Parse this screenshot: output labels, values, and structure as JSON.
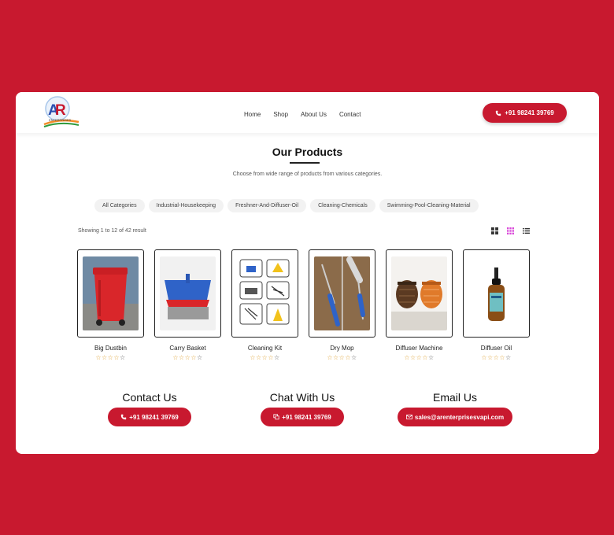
{
  "brand": {
    "logo_text": "ENTERPRISES",
    "logo_letters": "AR"
  },
  "nav": [
    "Home",
    "Shop",
    "About Us",
    "Contact"
  ],
  "header_phone": "+91 98241 39769",
  "section": {
    "title": "Our Products",
    "subtitle": "Choose from wide range of products from various categories."
  },
  "filters": [
    "All Categories",
    "Industrial-Housekeeping",
    "Freshner-And-Diffuser-Oil",
    "Cleaning-Chemicals",
    "Swimming-Pool-Cleaning-Material"
  ],
  "showing": "Showing 1 to 12 of 42 result",
  "view_icons": [
    "grid-large-icon",
    "grid-small-icon",
    "list-icon"
  ],
  "products": [
    {
      "name": "Big Dustbin",
      "rating": 0
    },
    {
      "name": "Carry Basket",
      "rating": 0
    },
    {
      "name": "Cleaning Kit",
      "rating": 0
    },
    {
      "name": "Dry Mop",
      "rating": 0
    },
    {
      "name": "Diffuser Machine",
      "rating": 0
    },
    {
      "name": "Diffuser Oil",
      "rating": 0
    }
  ],
  "contact": {
    "call": {
      "heading": "Contact Us",
      "label": "+91 98241 39769"
    },
    "chat": {
      "heading": "Chat With Us",
      "label": "+91 98241 39769"
    },
    "email": {
      "heading": "Email Us",
      "label": "sales@arenterprisesvapi.com"
    }
  },
  "colors": {
    "accent": "#c8192f",
    "background": "#c8192f",
    "star": "#e0a53a",
    "active_view": "#d94ad9"
  }
}
